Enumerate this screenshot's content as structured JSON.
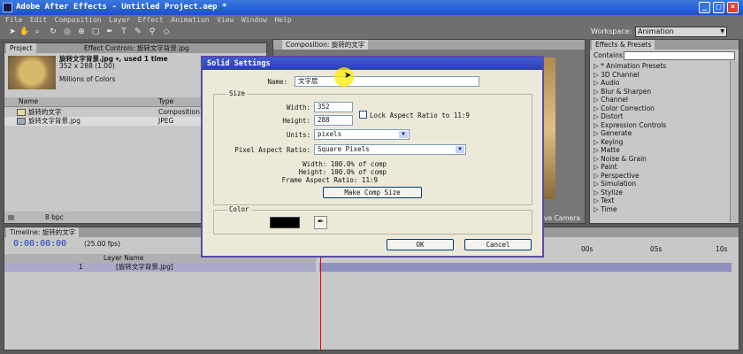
{
  "window": {
    "title": "Adobe After Effects - Untitled Project.aep *"
  },
  "menu": [
    "File",
    "Edit",
    "Composition",
    "Layer",
    "Effect",
    "Animation",
    "View",
    "Window",
    "Help"
  ],
  "workspace": {
    "label": "Workspace:",
    "value": "Animation"
  },
  "project_panel": {
    "tabs": [
      "Project",
      "Effect Controls: 旋转文字背景.jpg"
    ],
    "footage_name": "旋转文字背景.jpg ▾, used 1 time",
    "footage_size": "352 x 288 (1.00)",
    "footage_colors": "Millions of Colors",
    "columns": [
      "Name",
      "Type"
    ],
    "items": [
      {
        "name": "旋转的文字",
        "type": "Composition"
      },
      {
        "name": "旋转文字背景.jpg",
        "type": "JPEG"
      }
    ],
    "bpc": "8 bpc"
  },
  "comp_panel": {
    "tab": "Composition: 旋转的文字",
    "camera": "ive Camera"
  },
  "effects_panel": {
    "tab": "Effects & Presets",
    "contains_label": "Contains:",
    "items": [
      "* Animation Presets",
      "3D Channel",
      "Audio",
      "Blur & Sharpen",
      "Channel",
      "Color Correction",
      "Distort",
      "Expression Controls",
      "Generate",
      "Keying",
      "Matte",
      "Noise & Grain",
      "Paint",
      "Perspective",
      "Simulation",
      "Stylize",
      "Text",
      "Time"
    ]
  },
  "timeline": {
    "tab": "Timeline: 旋转的文字",
    "timecode": "0:00:00:00",
    "fps": "(25.00 fps)",
    "col_layer": "Layer Name",
    "layer_index": "1",
    "layer_name": "[旋转文字背景.jpg]",
    "ruler": [
      "00s",
      "05s",
      "10s"
    ]
  },
  "dialog": {
    "title": "Solid Settings",
    "name_label": "Name:",
    "name_value": "文字层",
    "size_group": "Size",
    "width_label": "Width:",
    "width_value": "352",
    "height_label": "Height:",
    "height_value": "288",
    "lock_label": "Lock Aspect Ratio to 11:9",
    "units_label": "Units:",
    "units_value": "pixels",
    "par_label": "Pixel Aspect Ratio:",
    "par_value": "Square Pixels",
    "info_width": "Width:  100.0% of comp",
    "info_height": "Height:  100.0% of comp",
    "info_frame": "Frame Aspect Ratio: 11:9",
    "make_comp_size": "Make Comp Size",
    "color_group": "Color",
    "ok": "OK",
    "cancel": "Cancel"
  },
  "colors": {
    "solid_color": "#000000",
    "accent": "#2b3fb0",
    "cursor": "#ffee00"
  }
}
